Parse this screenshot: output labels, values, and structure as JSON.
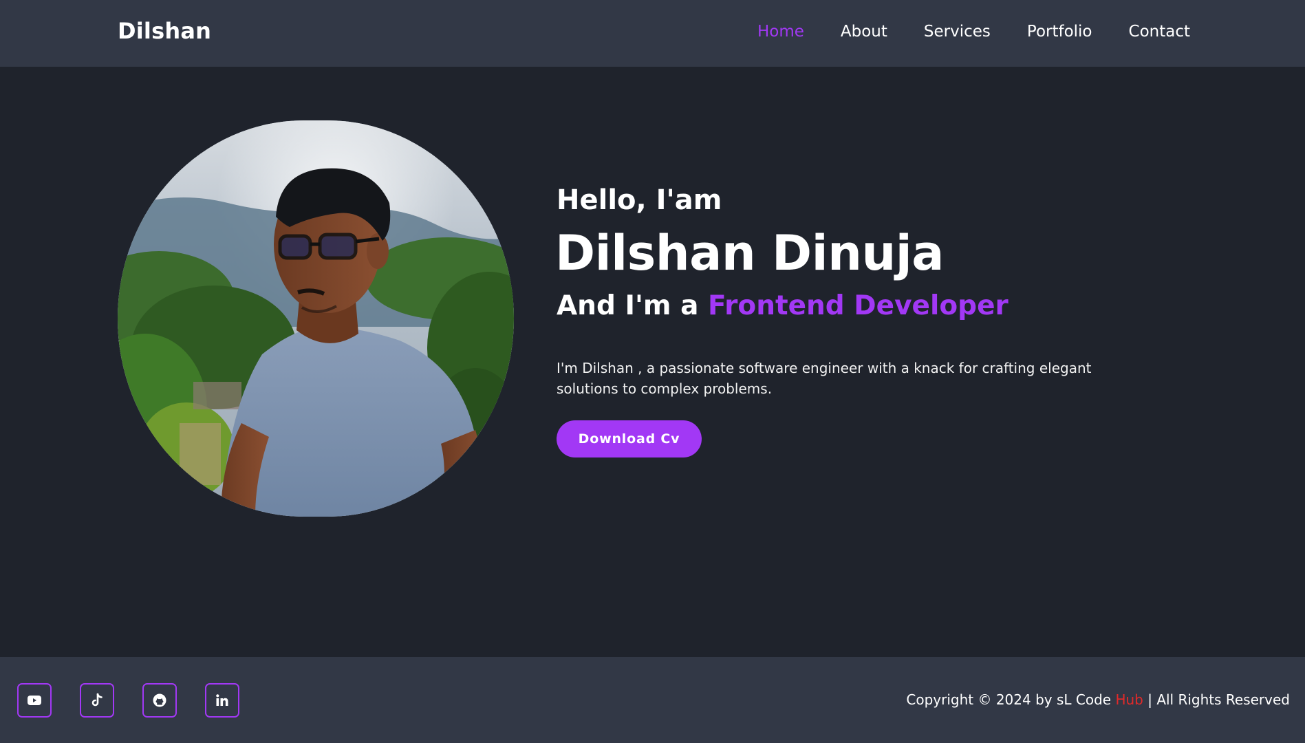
{
  "brand": "Dilshan",
  "nav": {
    "items": [
      {
        "label": "Home",
        "active": true
      },
      {
        "label": "About"
      },
      {
        "label": "Services"
      },
      {
        "label": "Portfolio"
      },
      {
        "label": "Contact"
      }
    ]
  },
  "hero": {
    "greeting": "Hello, I'am",
    "name": "Dilshan Dinuja",
    "role_prefix": "And I'm a ",
    "role_highlight": "Frontend Developer",
    "description": "I'm Dilshan , a passionate software engineer with a knack for crafting elegant solutions to complex problems.",
    "cta_label": "Download Cv"
  },
  "footer": {
    "socials": [
      {
        "icon": "youtube-icon"
      },
      {
        "icon": "tiktok-icon"
      },
      {
        "icon": "github-icon"
      },
      {
        "icon": "linkedin-icon"
      }
    ],
    "copyright_prefix": "Copyright © 2024 by sL Code ",
    "copyright_hub": "Hub",
    "copyright_suffix": " | All Rights Reserved"
  },
  "colors": {
    "accent": "#a238f5",
    "header_bg": "#323846",
    "page_bg": "#1f232c",
    "hub_red": "#e12a2a"
  }
}
